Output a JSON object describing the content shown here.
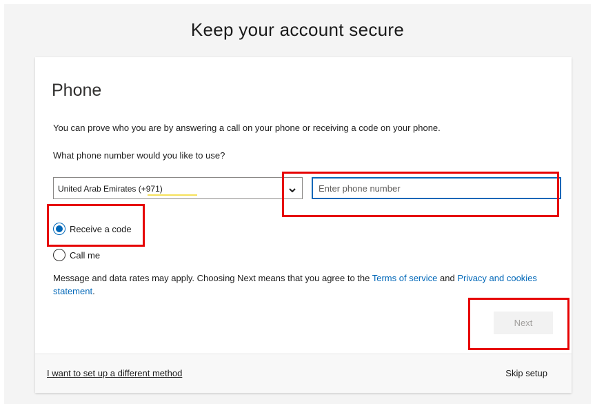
{
  "page": {
    "title": "Keep your account secure"
  },
  "card": {
    "heading": "Phone",
    "description": "You can prove who you are by answering a call on your phone or receiving a code on your phone.",
    "question": "What phone number would you like to use?",
    "country": {
      "selected": "United Arab Emirates (+971)"
    },
    "phone": {
      "value": "",
      "placeholder": "Enter phone number"
    },
    "methods": [
      {
        "label": "Receive a code",
        "checked": true
      },
      {
        "label": "Call me",
        "checked": false
      }
    ],
    "legal": {
      "prefix": "Message and data rates may apply. Choosing Next means that you agree to the ",
      "terms_link": "Terms of service",
      "and": " and ",
      "privacy_link": "Privacy and cookies statement",
      "suffix": "."
    },
    "next_label": "Next"
  },
  "footer": {
    "different_method": "I want to set up a different method",
    "skip": "Skip setup"
  },
  "colors": {
    "accent": "#0067b8",
    "annotation": "#e60000",
    "highlight": "#f6e15a"
  },
  "icons": {
    "select_arrow": "chevron-down-icon"
  }
}
